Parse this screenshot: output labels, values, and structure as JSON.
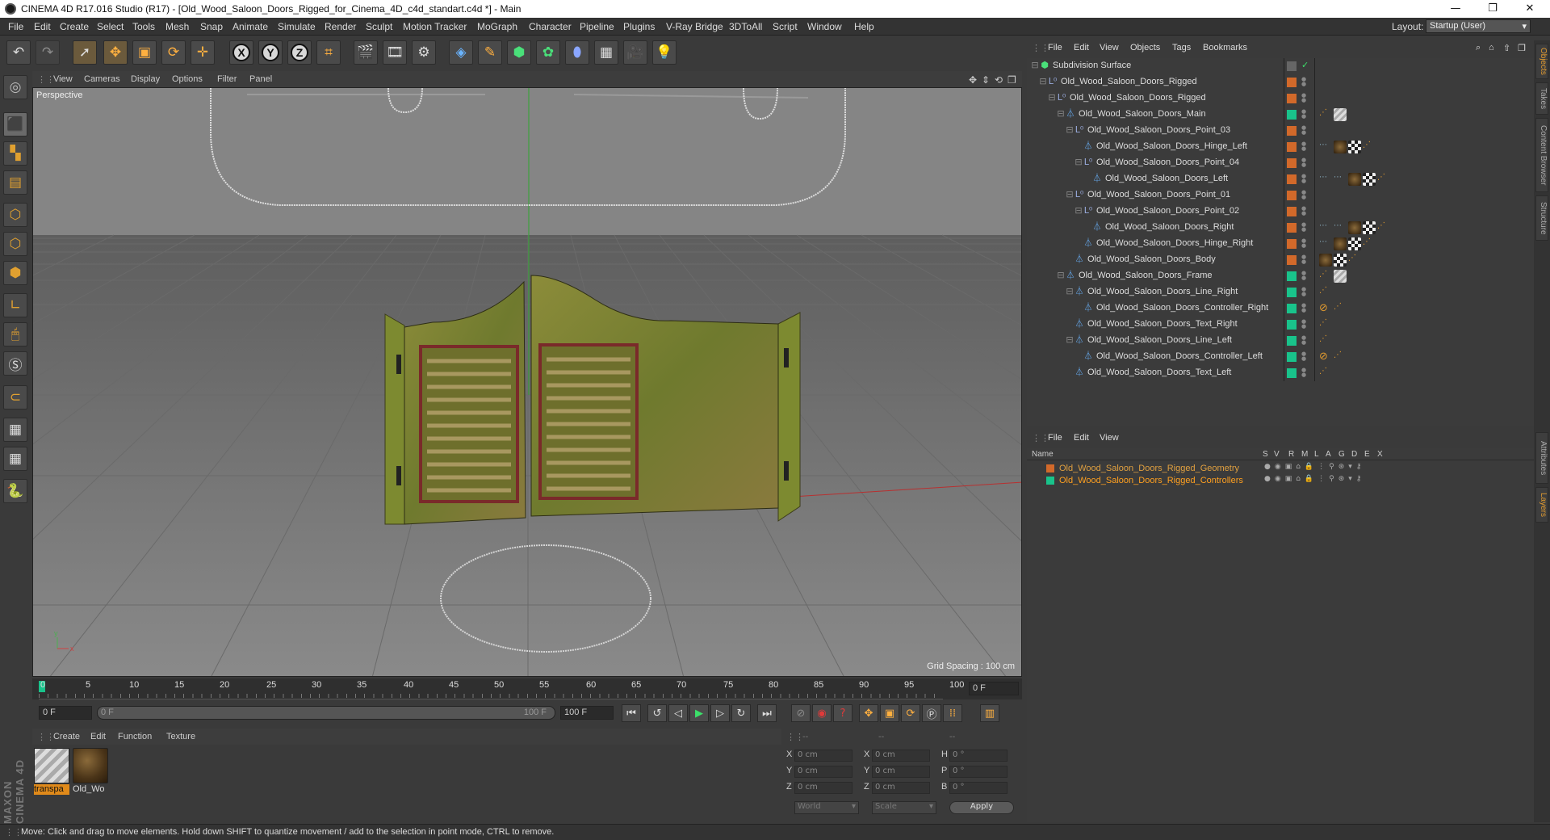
{
  "window": {
    "title": "CINEMA 4D R17.016 Studio (R17) - [Old_Wood_Saloon_Doors_Rigged_for_Cinema_4D_c4d_standart.c4d *] - Main",
    "controls": [
      "—",
      "❐",
      "✕"
    ]
  },
  "menubar": {
    "items": [
      "File",
      "Edit",
      "Create",
      "Select",
      "Tools",
      "Mesh",
      "Snap",
      "Animate",
      "Simulate",
      "Render",
      "Sculpt",
      "Motion Tracker",
      "MoGraph",
      "Character",
      "Pipeline",
      "Plugins",
      "V-Ray Bridge",
      "3DToAll",
      "Script",
      "Window",
      "Help"
    ],
    "layout_label": "Layout:",
    "layout_value": "Startup (User)"
  },
  "toolbar": {
    "axis_x": "X",
    "axis_y": "Y",
    "axis_z": "Z"
  },
  "viewport": {
    "menu": [
      "View",
      "Cameras",
      "Display",
      "Options",
      "Filter",
      "Panel"
    ],
    "label": "Perspective",
    "grid_spacing": "Grid Spacing : 100 cm"
  },
  "timeline": {
    "ticks": [
      "0",
      "5",
      "10",
      "15",
      "20",
      "25",
      "30",
      "35",
      "40",
      "45",
      "50",
      "55",
      "60",
      "65",
      "70",
      "75",
      "80",
      "85",
      "90",
      "95",
      "100"
    ],
    "current_frame": "0 F",
    "start_field": "0 F",
    "slider_start": "0 F",
    "slider_end": "100 F",
    "end_field": "100 F"
  },
  "material_manager": {
    "menu": [
      "Create",
      "Edit",
      "Function",
      "Texture"
    ],
    "materials": [
      {
        "label": "transpa",
        "selected": true
      },
      {
        "label": "Old_Wo",
        "selected": false
      }
    ]
  },
  "coordinates": {
    "headers": [
      "--",
      "--",
      "--"
    ],
    "rows": [
      {
        "a": "X",
        "av": "0 cm",
        "b": "X",
        "bv": "0 cm",
        "c": "H",
        "cv": "0 °"
      },
      {
        "a": "Y",
        "av": "0 cm",
        "b": "Y",
        "bv": "0 cm",
        "c": "P",
        "cv": "0 °"
      },
      {
        "a": "Z",
        "av": "0 cm",
        "b": "Z",
        "bv": "0 cm",
        "c": "B",
        "cv": "0 °"
      }
    ],
    "world": "World",
    "scale": "Scale",
    "apply": "Apply"
  },
  "status": {
    "text": "Move: Click and drag to move elements. Hold down SHIFT to quantize movement / add to the selection in point mode, CTRL to remove."
  },
  "object_manager": {
    "menu": [
      "File",
      "Edit",
      "View",
      "Objects",
      "Tags",
      "Bookmarks"
    ],
    "objects": [
      {
        "name": "Subdivision Surface",
        "depth": 0,
        "icon": "subdivision-icon",
        "color": "none"
      },
      {
        "name": "Old_Wood_Saloon_Doors_Rigged",
        "depth": 1,
        "icon": "null-icon",
        "color": "#d2692a"
      },
      {
        "name": "Old_Wood_Saloon_Doors_Rigged",
        "depth": 2,
        "icon": "null-icon",
        "color": "#d2692a"
      },
      {
        "name": "Old_Wood_Saloon_Doors_Main",
        "depth": 3,
        "icon": "joint-icon",
        "color": "#19c38b"
      },
      {
        "name": "Old_Wood_Saloon_Doors_Point_03",
        "depth": 4,
        "icon": "null-icon",
        "color": "#d2692a"
      },
      {
        "name": "Old_Wood_Saloon_Doors_Hinge_Left",
        "depth": 5,
        "icon": "joint-icon",
        "color": "#d2692a"
      },
      {
        "name": "Old_Wood_Saloon_Doors_Point_04",
        "depth": 5,
        "icon": "null-icon",
        "color": "#d2692a"
      },
      {
        "name": "Old_Wood_Saloon_Doors_Left",
        "depth": 6,
        "icon": "joint-icon",
        "color": "#d2692a"
      },
      {
        "name": "Old_Wood_Saloon_Doors_Point_01",
        "depth": 4,
        "icon": "null-icon",
        "color": "#d2692a"
      },
      {
        "name": "Old_Wood_Saloon_Doors_Point_02",
        "depth": 5,
        "icon": "null-icon",
        "color": "#d2692a"
      },
      {
        "name": "Old_Wood_Saloon_Doors_Right",
        "depth": 6,
        "icon": "joint-icon",
        "color": "#d2692a"
      },
      {
        "name": "Old_Wood_Saloon_Doors_Hinge_Right",
        "depth": 5,
        "icon": "joint-icon",
        "color": "#d2692a"
      },
      {
        "name": "Old_Wood_Saloon_Doors_Body",
        "depth": 4,
        "icon": "joint-icon",
        "color": "#d2692a"
      },
      {
        "name": "Old_Wood_Saloon_Doors_Frame",
        "depth": 3,
        "icon": "joint-icon",
        "color": "#19c38b"
      },
      {
        "name": "Old_Wood_Saloon_Doors_Line_Right",
        "depth": 4,
        "icon": "joint-icon",
        "color": "#19c38b"
      },
      {
        "name": "Old_Wood_Saloon_Doors_Controller_Right",
        "depth": 5,
        "icon": "joint-icon",
        "color": "#19c38b"
      },
      {
        "name": "Old_Wood_Saloon_Doors_Text_Right",
        "depth": 4,
        "icon": "joint-icon",
        "color": "#19c38b"
      },
      {
        "name": "Old_Wood_Saloon_Doors_Line_Left",
        "depth": 4,
        "icon": "joint-icon",
        "color": "#19c38b"
      },
      {
        "name": "Old_Wood_Saloon_Doors_Controller_Left",
        "depth": 5,
        "icon": "joint-icon",
        "color": "#19c38b"
      },
      {
        "name": "Old_Wood_Saloon_Doors_Text_Left",
        "depth": 4,
        "icon": "joint-icon",
        "color": "#19c38b"
      }
    ]
  },
  "layer_manager": {
    "menu": [
      "File",
      "Edit",
      "View"
    ],
    "columns": [
      "Name",
      "S",
      "V",
      "R",
      "M",
      "L",
      "A",
      "G",
      "D",
      "E",
      "X"
    ],
    "layers": [
      {
        "name": "Old_Wood_Saloon_Doors_Rigged_Geometry",
        "color": "#d2692a",
        "text_color": "#e0a040"
      },
      {
        "name": "Old_Wood_Saloon_Doors_Rigged_Controllers",
        "color": "#19c38b",
        "text_color": "#ffa020"
      }
    ]
  },
  "side_tabs": [
    "Objects",
    "Takes",
    "Content Browser",
    "Structure",
    "Attributes",
    "Layers"
  ],
  "brand": "MAXON CINEMA 4D"
}
